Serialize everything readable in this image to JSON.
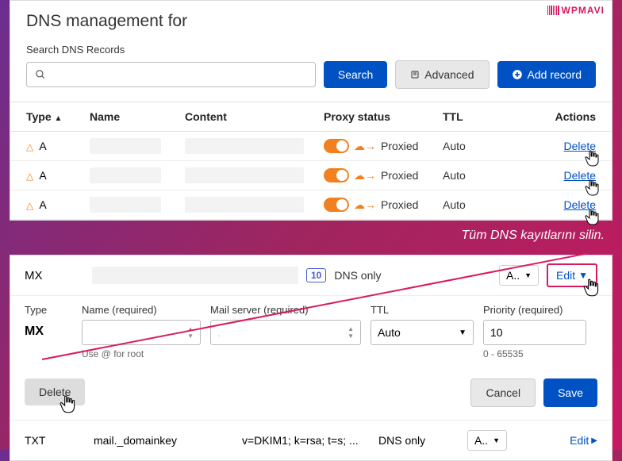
{
  "brand": "WPMAVI",
  "panel1": {
    "title": "DNS management for",
    "search_label": "Search DNS Records",
    "buttons": {
      "search": "Search",
      "advanced": "Advanced",
      "add": "Add record"
    },
    "headers": {
      "type": "Type",
      "name": "Name",
      "content": "Content",
      "proxy": "Proxy status",
      "ttl": "TTL",
      "actions": "Actions"
    },
    "rows": [
      {
        "type": "A",
        "proxy": "Proxied",
        "ttl": "Auto",
        "action": "Delete"
      },
      {
        "type": "A",
        "proxy": "Proxied",
        "ttl": "Auto",
        "action": "Delete"
      },
      {
        "type": "A",
        "proxy": "Proxied",
        "ttl": "Auto",
        "action": "Delete"
      }
    ]
  },
  "caption": "Tüm DNS kayıtlarını silin.",
  "panel2": {
    "row1": {
      "type": "MX",
      "badge": "10",
      "status": "DNS only",
      "ttl": "A..",
      "edit": "Edit"
    },
    "form": {
      "type_label": "Type",
      "type_val": "MX",
      "name_label": "Name (required)",
      "name_helper": "Use @ for root",
      "mail_label": "Mail server (required)",
      "ttl_label": "TTL",
      "ttl_val": "Auto",
      "prio_label": "Priority (required)",
      "prio_val": "10",
      "prio_helper": "0 - 65535"
    },
    "actions": {
      "delete": "Delete",
      "cancel": "Cancel",
      "save": "Save"
    },
    "txt": {
      "type": "TXT",
      "name": "mail._domainkey",
      "val": "v=DKIM1; k=rsa; t=s; ...",
      "status": "DNS only",
      "ttl": "A..",
      "edit": "Edit"
    }
  }
}
